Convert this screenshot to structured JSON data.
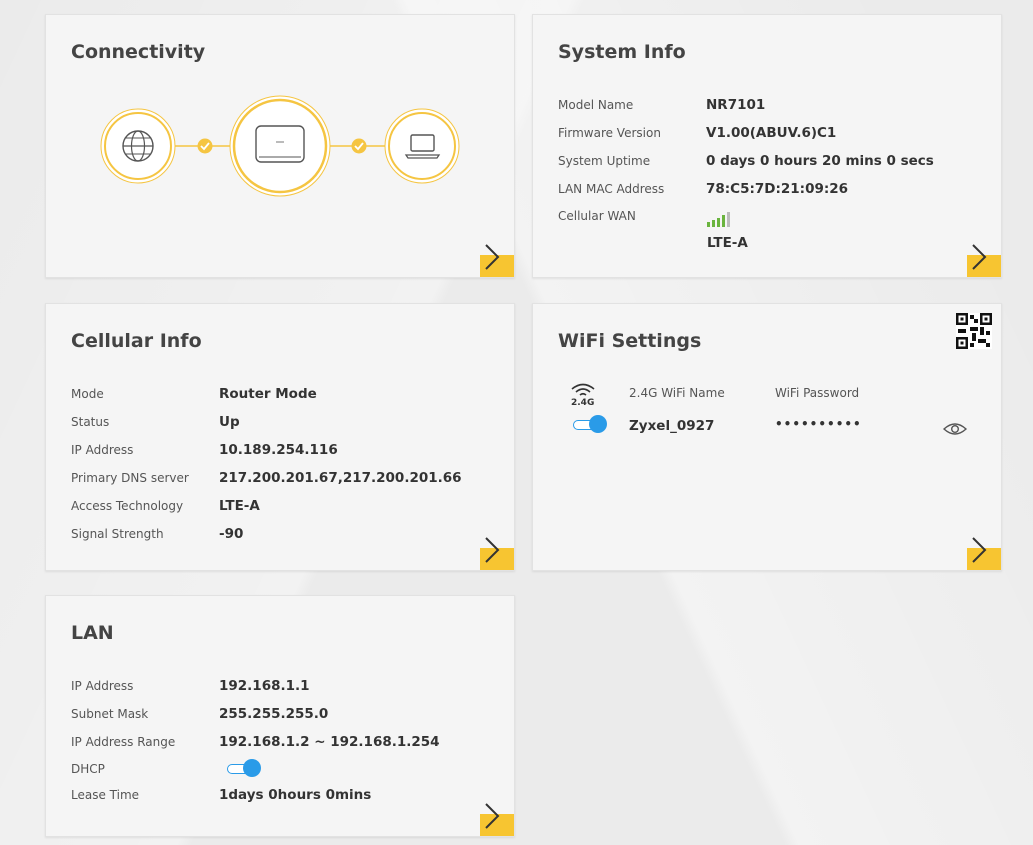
{
  "connectivity": {
    "title": "Connectivity"
  },
  "system_info": {
    "title": "System Info",
    "rows": [
      {
        "label": "Model Name",
        "value": "NR7101"
      },
      {
        "label": "Firmware Version",
        "value": "V1.00(ABUV.6)C1"
      },
      {
        "label": "System Uptime",
        "value": "0 days 0 hours 20 mins 0 secs"
      },
      {
        "label": "LAN MAC Address",
        "value": "78:C5:7D:21:09:26"
      }
    ],
    "cellular_wan_label": "Cellular WAN",
    "cellular_wan_value": "LTE-A",
    "signal_bars_filled": 4,
    "signal_bars_total": 5
  },
  "cellular_info": {
    "title": "Cellular Info",
    "rows": [
      {
        "label": "Mode",
        "value": "Router Mode"
      },
      {
        "label": "Status",
        "value": "Up"
      },
      {
        "label": "IP Address",
        "value": "10.189.254.116"
      },
      {
        "label": "Primary DNS server",
        "value": "217.200.201.67,217.200.201.66"
      },
      {
        "label": "Access Technology",
        "value": "LTE-A"
      },
      {
        "label": "Signal Strength",
        "value": "-90"
      }
    ]
  },
  "wifi_settings": {
    "title": "WiFi Settings",
    "band_label": "2.4G",
    "name_header": "2.4G WiFi Name",
    "password_header": "WiFi Password",
    "ssid": "Zyxel_0927",
    "password_masked": "••••••••••",
    "enabled": true
  },
  "lan": {
    "title": "LAN",
    "rows": [
      {
        "label": "IP Address",
        "value": "192.168.1.1"
      },
      {
        "label": "Subnet Mask",
        "value": "255.255.255.0"
      },
      {
        "label": "IP Address Range",
        "value": "192.168.1.2 ~ 192.168.1.254"
      }
    ],
    "dhcp_label": "DHCP",
    "dhcp_enabled": true,
    "lease_label": "Lease Time",
    "lease_value": "1days 0hours 0mins"
  },
  "colors": {
    "accent_yellow": "#f7c531",
    "toggle_blue": "#2a9be8",
    "signal_green": "#6ab43e",
    "ring_orange": "#f5c542"
  }
}
